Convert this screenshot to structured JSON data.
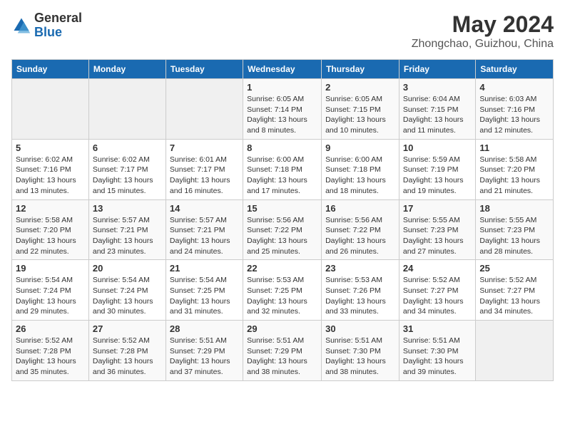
{
  "header": {
    "logo_general": "General",
    "logo_blue": "Blue",
    "title": "May 2024",
    "location": "Zhongchao, Guizhou, China"
  },
  "weekdays": [
    "Sunday",
    "Monday",
    "Tuesday",
    "Wednesday",
    "Thursday",
    "Friday",
    "Saturday"
  ],
  "weeks": [
    [
      {
        "day": "",
        "info": ""
      },
      {
        "day": "",
        "info": ""
      },
      {
        "day": "",
        "info": ""
      },
      {
        "day": "1",
        "info": "Sunrise: 6:05 AM\nSunset: 7:14 PM\nDaylight: 13 hours\nand 8 minutes."
      },
      {
        "day": "2",
        "info": "Sunrise: 6:05 AM\nSunset: 7:15 PM\nDaylight: 13 hours\nand 10 minutes."
      },
      {
        "day": "3",
        "info": "Sunrise: 6:04 AM\nSunset: 7:15 PM\nDaylight: 13 hours\nand 11 minutes."
      },
      {
        "day": "4",
        "info": "Sunrise: 6:03 AM\nSunset: 7:16 PM\nDaylight: 13 hours\nand 12 minutes."
      }
    ],
    [
      {
        "day": "5",
        "info": "Sunrise: 6:02 AM\nSunset: 7:16 PM\nDaylight: 13 hours\nand 13 minutes."
      },
      {
        "day": "6",
        "info": "Sunrise: 6:02 AM\nSunset: 7:17 PM\nDaylight: 13 hours\nand 15 minutes."
      },
      {
        "day": "7",
        "info": "Sunrise: 6:01 AM\nSunset: 7:17 PM\nDaylight: 13 hours\nand 16 minutes."
      },
      {
        "day": "8",
        "info": "Sunrise: 6:00 AM\nSunset: 7:18 PM\nDaylight: 13 hours\nand 17 minutes."
      },
      {
        "day": "9",
        "info": "Sunrise: 6:00 AM\nSunset: 7:18 PM\nDaylight: 13 hours\nand 18 minutes."
      },
      {
        "day": "10",
        "info": "Sunrise: 5:59 AM\nSunset: 7:19 PM\nDaylight: 13 hours\nand 19 minutes."
      },
      {
        "day": "11",
        "info": "Sunrise: 5:58 AM\nSunset: 7:20 PM\nDaylight: 13 hours\nand 21 minutes."
      }
    ],
    [
      {
        "day": "12",
        "info": "Sunrise: 5:58 AM\nSunset: 7:20 PM\nDaylight: 13 hours\nand 22 minutes."
      },
      {
        "day": "13",
        "info": "Sunrise: 5:57 AM\nSunset: 7:21 PM\nDaylight: 13 hours\nand 23 minutes."
      },
      {
        "day": "14",
        "info": "Sunrise: 5:57 AM\nSunset: 7:21 PM\nDaylight: 13 hours\nand 24 minutes."
      },
      {
        "day": "15",
        "info": "Sunrise: 5:56 AM\nSunset: 7:22 PM\nDaylight: 13 hours\nand 25 minutes."
      },
      {
        "day": "16",
        "info": "Sunrise: 5:56 AM\nSunset: 7:22 PM\nDaylight: 13 hours\nand 26 minutes."
      },
      {
        "day": "17",
        "info": "Sunrise: 5:55 AM\nSunset: 7:23 PM\nDaylight: 13 hours\nand 27 minutes."
      },
      {
        "day": "18",
        "info": "Sunrise: 5:55 AM\nSunset: 7:23 PM\nDaylight: 13 hours\nand 28 minutes."
      }
    ],
    [
      {
        "day": "19",
        "info": "Sunrise: 5:54 AM\nSunset: 7:24 PM\nDaylight: 13 hours\nand 29 minutes."
      },
      {
        "day": "20",
        "info": "Sunrise: 5:54 AM\nSunset: 7:24 PM\nDaylight: 13 hours\nand 30 minutes."
      },
      {
        "day": "21",
        "info": "Sunrise: 5:54 AM\nSunset: 7:25 PM\nDaylight: 13 hours\nand 31 minutes."
      },
      {
        "day": "22",
        "info": "Sunrise: 5:53 AM\nSunset: 7:25 PM\nDaylight: 13 hours\nand 32 minutes."
      },
      {
        "day": "23",
        "info": "Sunrise: 5:53 AM\nSunset: 7:26 PM\nDaylight: 13 hours\nand 33 minutes."
      },
      {
        "day": "24",
        "info": "Sunrise: 5:52 AM\nSunset: 7:27 PM\nDaylight: 13 hours\nand 34 minutes."
      },
      {
        "day": "25",
        "info": "Sunrise: 5:52 AM\nSunset: 7:27 PM\nDaylight: 13 hours\nand 34 minutes."
      }
    ],
    [
      {
        "day": "26",
        "info": "Sunrise: 5:52 AM\nSunset: 7:28 PM\nDaylight: 13 hours\nand 35 minutes."
      },
      {
        "day": "27",
        "info": "Sunrise: 5:52 AM\nSunset: 7:28 PM\nDaylight: 13 hours\nand 36 minutes."
      },
      {
        "day": "28",
        "info": "Sunrise: 5:51 AM\nSunset: 7:29 PM\nDaylight: 13 hours\nand 37 minutes."
      },
      {
        "day": "29",
        "info": "Sunrise: 5:51 AM\nSunset: 7:29 PM\nDaylight: 13 hours\nand 38 minutes."
      },
      {
        "day": "30",
        "info": "Sunrise: 5:51 AM\nSunset: 7:30 PM\nDaylight: 13 hours\nand 38 minutes."
      },
      {
        "day": "31",
        "info": "Sunrise: 5:51 AM\nSunset: 7:30 PM\nDaylight: 13 hours\nand 39 minutes."
      },
      {
        "day": "",
        "info": ""
      }
    ]
  ]
}
